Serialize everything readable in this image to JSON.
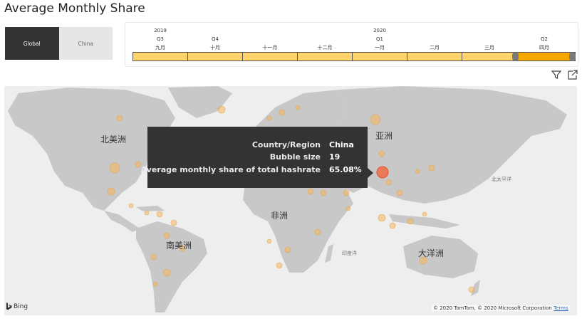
{
  "page_title": "Average Monthly Share",
  "toggle": {
    "global_label": "Global",
    "china_label": "China",
    "selected": "Global"
  },
  "timeline": {
    "year_2019": "2019",
    "year_2020": "2020",
    "q3": "Q3",
    "q4": "Q4",
    "q1": "Q1",
    "q2": "Q2",
    "months": [
      "九月",
      "十月",
      "十一月",
      "十二月",
      "一月",
      "二月",
      "三月",
      "四月"
    ],
    "selected_month": "四月"
  },
  "toolbar": {
    "filter_icon": "filter-icon",
    "focus_icon": "focus-mode-icon"
  },
  "map": {
    "labels": {
      "north_america": "北美洲",
      "asia": "亚洲",
      "africa": "非洲",
      "south_america": "南美洲",
      "oceania": "大洋洲",
      "north_pacific": "北太平洋",
      "indian_ocean": "印度洋"
    },
    "colors": {
      "bubble": "#f5b75a",
      "highlight": "#f26b43",
      "land": "#c8c8c8",
      "water": "#eeeeee"
    }
  },
  "tooltip": {
    "rows": [
      {
        "key": "Country/Region",
        "value": "China"
      },
      {
        "key": "Bubble size",
        "value": "19"
      },
      {
        "key": "Average monthly share of total hashrate",
        "value": "65.08%"
      }
    ]
  },
  "attribution": {
    "bing": "Bing",
    "copyright": "© 2020 TomTom, © 2020 Microsoft Corporation",
    "terms": "Terms"
  }
}
